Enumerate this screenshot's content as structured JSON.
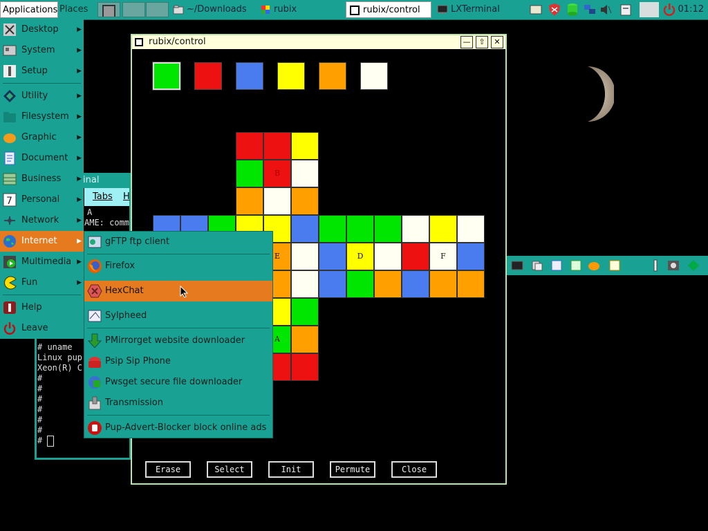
{
  "taskbar": {
    "applications": "Applications",
    "places": "Places",
    "tasks": [
      {
        "label": "~/Downloads",
        "icon": "folder-icon"
      },
      {
        "label": "rubix",
        "icon": "cube-icon"
      },
      {
        "label": "rubix/control",
        "icon": "window-icon"
      },
      {
        "label": "LXTerminal",
        "icon": "terminal-icon"
      }
    ],
    "clock": "01:12"
  },
  "terminal": {
    "title": "inal",
    "menu_tabs": "Tabs",
    "menu_h": "H",
    "lines_top": [
      "A",
      "AME: comm"
    ],
    "lines_bottom": [
      "# uname",
      "Linux pup",
      "Xeon(R) C",
      "#",
      "#",
      "#",
      "#",
      "#",
      "#",
      "# "
    ]
  },
  "rubix": {
    "title": "rubix/control",
    "minimize": "—",
    "maximize": "⇧",
    "close": "✕",
    "palette": [
      "#00e600",
      "#ee1111",
      "#4a7cf0",
      "#ffff00",
      "#ffa000",
      "#fffff2"
    ],
    "selected_palette_index": 0,
    "face_labels": {
      "B": "B",
      "E": "E",
      "D": "D",
      "F": "F",
      "A": "A"
    },
    "buttons": [
      "Erase",
      "Select",
      "Init",
      "Permute",
      "Close"
    ]
  },
  "app_menu": {
    "items": [
      {
        "label": "Desktop",
        "icon": "desktop-icon",
        "arrow": true
      },
      {
        "label": "System",
        "icon": "system-icon",
        "arrow": true
      },
      {
        "label": "Setup",
        "icon": "setup-icon",
        "arrow": true
      },
      {
        "label": "Utility",
        "icon": "utility-icon",
        "arrow": true
      },
      {
        "label": "Filesystem",
        "icon": "filesystem-icon",
        "arrow": true
      },
      {
        "label": "Graphic",
        "icon": "graphic-icon",
        "arrow": true
      },
      {
        "label": "Document",
        "icon": "document-icon",
        "arrow": true
      },
      {
        "label": "Business",
        "icon": "business-icon",
        "arrow": true
      },
      {
        "label": "Personal",
        "icon": "personal-icon",
        "arrow": true
      },
      {
        "label": "Network",
        "icon": "network-icon",
        "arrow": true
      },
      {
        "label": "Internet",
        "icon": "globe-icon",
        "arrow": true
      },
      {
        "label": "Multimedia",
        "icon": "multimedia-icon",
        "arrow": true
      },
      {
        "label": "Fun",
        "icon": "pacman-icon",
        "arrow": true
      },
      {
        "label": "Help",
        "icon": "help-icon",
        "arrow": false
      },
      {
        "label": "Leave",
        "icon": "power-icon",
        "arrow": false
      }
    ],
    "highlighted": "Internet"
  },
  "internet_menu": {
    "items": [
      {
        "label": "gFTP ftp client",
        "icon": "ftp-icon"
      },
      {
        "label": "Firefox",
        "icon": "firefox-icon"
      },
      {
        "label": "HexChat",
        "icon": "hexchat-icon"
      },
      {
        "label": "Sylpheed",
        "icon": "mail-icon"
      },
      {
        "label": "PMirrorget website downloader",
        "icon": "download-arrow-icon"
      },
      {
        "label": "Psip Sip Phone",
        "icon": "phone-icon"
      },
      {
        "label": "Pwsget secure file downloader",
        "icon": "secure-download-icon"
      },
      {
        "label": "Transmission",
        "icon": "transmission-icon"
      },
      {
        "label": "Pup-Advert-Blocker block online ads",
        "icon": "stop-hand-icon"
      }
    ],
    "highlighted": "HexChat"
  }
}
